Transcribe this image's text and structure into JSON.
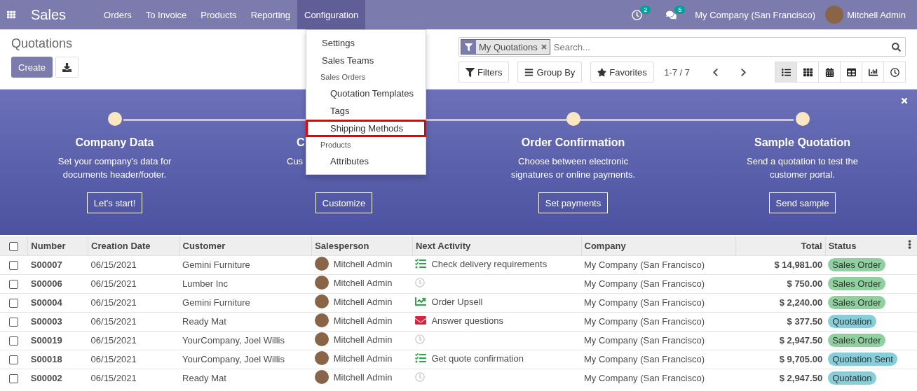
{
  "navbar": {
    "app": "Sales",
    "menus": [
      {
        "label": "Orders",
        "selected": false
      },
      {
        "label": "To Invoice",
        "selected": false
      },
      {
        "label": "Products",
        "selected": false
      },
      {
        "label": "Reporting",
        "selected": false
      },
      {
        "label": "Configuration",
        "selected": true
      }
    ],
    "activity_count": "2",
    "message_count": "5",
    "company": "My Company (San Francisco)",
    "user": "Mitchell Admin"
  },
  "dropdown": [
    {
      "label": "Settings",
      "highlighted": false
    },
    {
      "label": "Sales Teams",
      "highlighted": false
    },
    {
      "label": "Sales Orders",
      "children": [
        {
          "label": "Quotation Templates",
          "highlighted": false
        },
        {
          "label": "Tags",
          "highlighted": false
        },
        {
          "label": "Shipping Methods",
          "highlighted": true
        }
      ]
    },
    {
      "label": "Products",
      "children": [
        {
          "label": "Attributes",
          "highlighted": false
        }
      ]
    }
  ],
  "control_panel": {
    "title": "Quotations",
    "create": "Create",
    "facet": "My Quotations",
    "search_placeholder": "Search...",
    "filters": "Filters",
    "group_by": "Group By",
    "favorites": "Favorites",
    "pager": "1-7 / 7",
    "views": [
      {
        "kind": "list",
        "selected": true
      },
      {
        "kind": "kanban",
        "selected": false
      },
      {
        "kind": "calendar",
        "selected": false
      },
      {
        "kind": "pivot",
        "selected": false
      },
      {
        "kind": "graph",
        "selected": false
      },
      {
        "kind": "activity",
        "selected": false
      }
    ]
  },
  "banner": {
    "steps": [
      {
        "kind": "full",
        "title": "Company Data",
        "description": "Set your company's data for documents header/footer.",
        "button": "Let's start!"
      },
      {
        "kind": "covered",
        "title": "C",
        "description": "Cus",
        "button": "Customize"
      },
      {
        "kind": "full",
        "title": "Order Confirmation",
        "description": "Choose between electronic signatures or online payments.",
        "button": "Set payments"
      },
      {
        "kind": "full",
        "title": "Sample Quotation",
        "description": "Send a quotation to test the customer portal.",
        "button": "Send sample"
      }
    ]
  },
  "table": {
    "select_all": {
      "checked": false
    },
    "columns": [
      "Number",
      "Creation Date",
      "Customer",
      "Salesperson",
      "Next Activity",
      "Company",
      "Total",
      "Status"
    ],
    "rows": [
      {
        "checked": false,
        "number": "S00007",
        "date": "06/15/2021",
        "customer": "Gemini Furniture",
        "salesperson": "Mitchell Admin",
        "activity": {
          "kind": "todo",
          "label": "Check delivery requirements"
        },
        "company": "My Company (San Francisco)",
        "total": "$ 14,981.00",
        "status": {
          "label": "Sales Order",
          "color": "#8fd19e"
        }
      },
      {
        "checked": false,
        "number": "S00006",
        "date": "06/15/2021",
        "customer": "Lumber Inc",
        "salesperson": "Mitchell Admin",
        "activity": {
          "kind": "none"
        },
        "company": "My Company (San Francisco)",
        "total": "$ 750.00",
        "status": {
          "label": "Sales Order",
          "color": "#8fd19e"
        }
      },
      {
        "checked": false,
        "number": "S00004",
        "date": "06/15/2021",
        "customer": "Gemini Furniture",
        "salesperson": "Mitchell Admin",
        "activity": {
          "kind": "upsell",
          "label": "Order Upsell"
        },
        "company": "My Company (San Francisco)",
        "total": "$ 2,240.00",
        "status": {
          "label": "Sales Order",
          "color": "#8fd19e"
        }
      },
      {
        "checked": false,
        "number": "S00003",
        "date": "06/15/2021",
        "customer": "Ready Mat",
        "salesperson": "Mitchell Admin",
        "activity": {
          "kind": "email",
          "label": "Answer questions"
        },
        "company": "My Company (San Francisco)",
        "total": "$ 377.50",
        "status": {
          "label": "Quotation",
          "color": "#86cfda"
        }
      },
      {
        "checked": false,
        "number": "S00019",
        "date": "06/15/2021",
        "customer": "YourCompany, Joel Willis",
        "salesperson": "Mitchell Admin",
        "activity": {
          "kind": "none"
        },
        "company": "My Company (San Francisco)",
        "total": "$ 2,947.50",
        "status": {
          "label": "Sales Order",
          "color": "#8fd19e"
        }
      },
      {
        "checked": false,
        "number": "S00018",
        "date": "06/15/2021",
        "customer": "YourCompany, Joel Willis",
        "salesperson": "Mitchell Admin",
        "activity": {
          "kind": "todo",
          "label": "Get quote confirmation"
        },
        "company": "My Company (San Francisco)",
        "total": "$ 9,705.00",
        "status": {
          "label": "Quotation Sent",
          "color": "#86cfda"
        }
      },
      {
        "checked": false,
        "number": "S00002",
        "date": "06/15/2021",
        "customer": "Ready Mat",
        "salesperson": "Mitchell Admin",
        "activity": {
          "kind": "none"
        },
        "company": "My Company (San Francisco)",
        "total": "$ 2,947.50",
        "status": {
          "label": "Quotation",
          "color": "#86cfda"
        }
      }
    ]
  }
}
